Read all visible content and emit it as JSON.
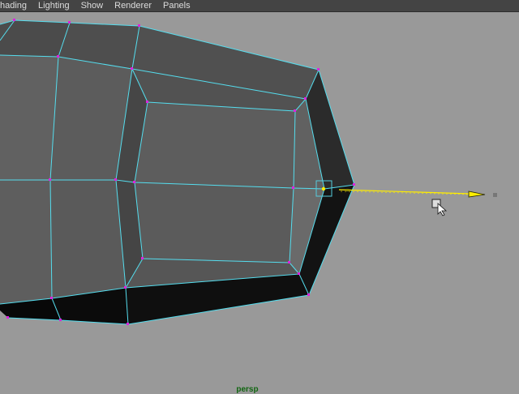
{
  "menubar": {
    "items": [
      {
        "label": "hading"
      },
      {
        "label": "Lighting"
      },
      {
        "label": "Show"
      },
      {
        "label": "Renderer"
      },
      {
        "label": "Panels"
      }
    ]
  },
  "viewport": {
    "camera_label": "persp",
    "background_color": "#999999",
    "wire_color": "#55ddee",
    "vertex_color": "#dd22dd",
    "manipulator_color": "#ffee00"
  },
  "cursor": {
    "icon": "arrow-cursor-icon"
  }
}
